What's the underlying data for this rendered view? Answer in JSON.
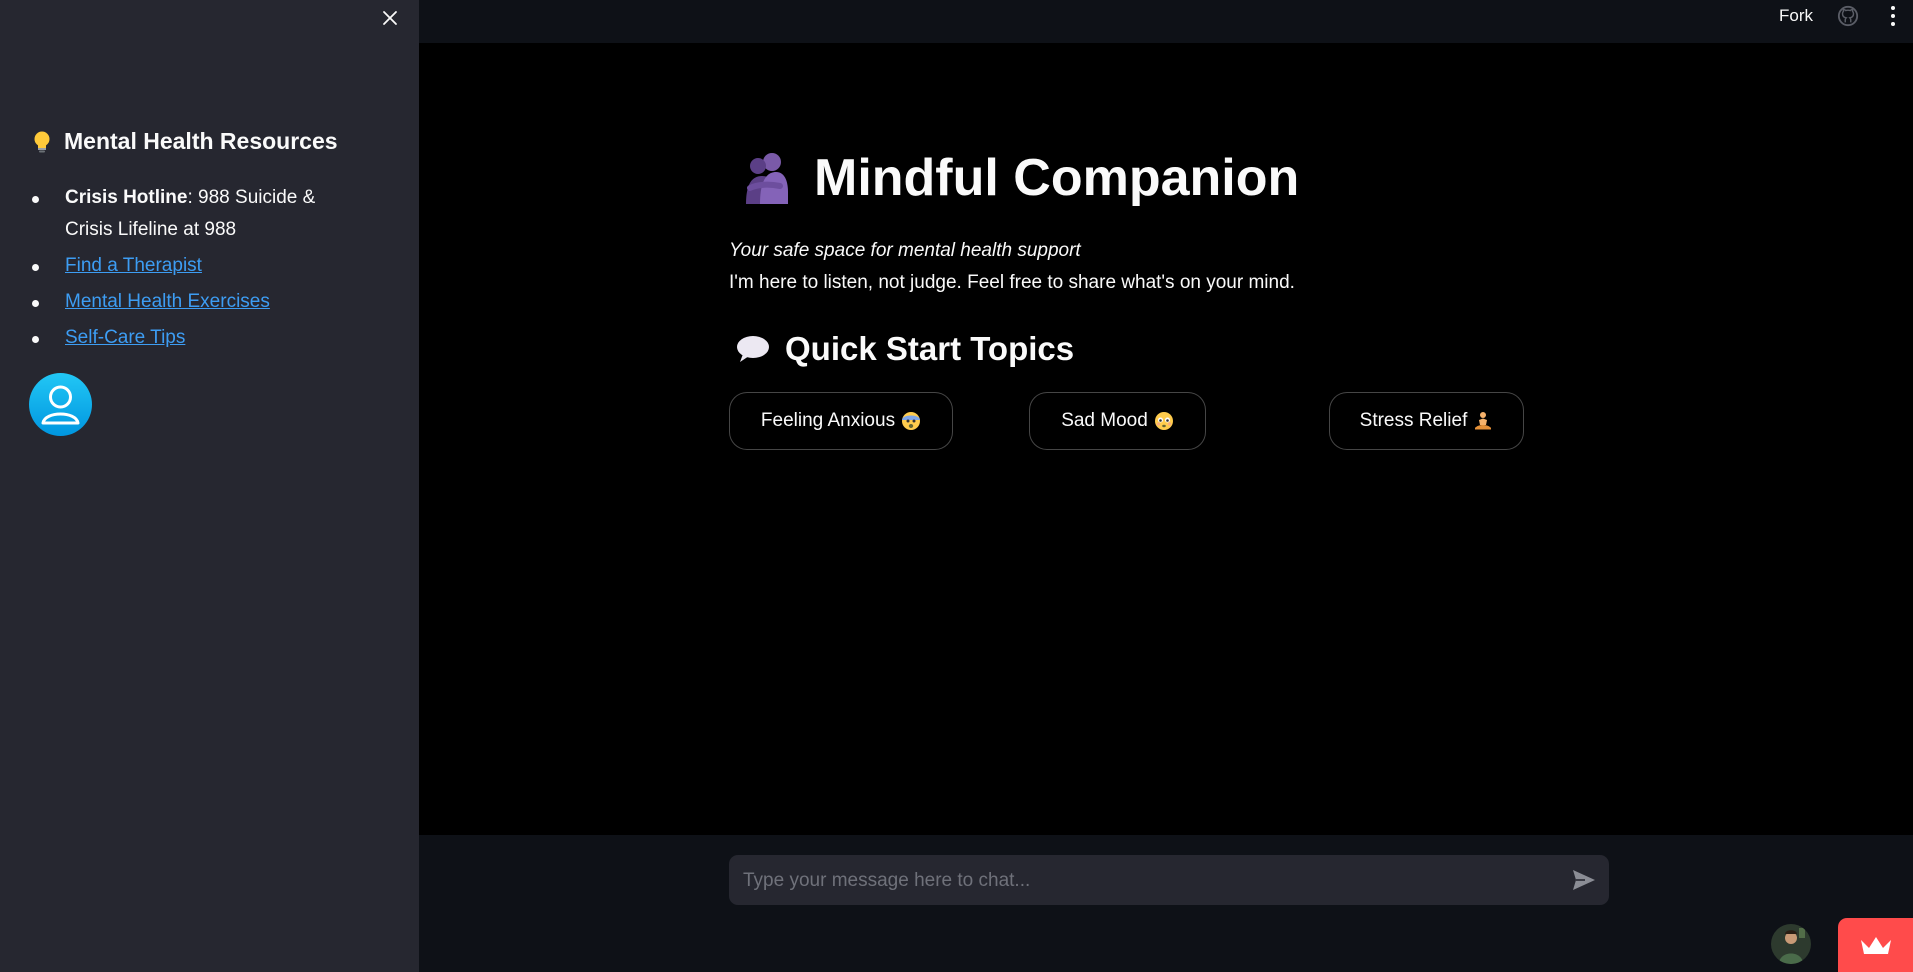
{
  "sidebar": {
    "close_icon": "close-icon",
    "title_icon": "lightbulb-icon",
    "title": "Mental Health Resources",
    "crisis": {
      "label": "Crisis Hotline",
      "text": ": 988 Suicide & Crisis Lifeline at 988"
    },
    "links": [
      {
        "label": "Find a Therapist"
      },
      {
        "label": "Mental Health Exercises"
      },
      {
        "label": "Self-Care Tips"
      }
    ],
    "avatar_icon": "user-avatar-icon"
  },
  "header": {
    "fork_label": "Fork",
    "github_icon": "github-icon",
    "menu_icon": "more-vertical-icon"
  },
  "main": {
    "title_icon": "people-hugging-icon",
    "title": "Mindful Companion",
    "subtitle": "Your safe space for mental health support",
    "tagline": "I'm here to listen, not judge. Feel free to share what's on your mind.",
    "quick_start": {
      "icon": "speech-balloon-icon",
      "title": "Quick Start Topics",
      "topics": [
        {
          "label": "Feeling Anxious",
          "emoji": "anxious-face-emoji"
        },
        {
          "label": "Sad Mood",
          "emoji": "sad-face-emoji"
        },
        {
          "label": "Stress Relief",
          "emoji": "meditating-person-emoji"
        }
      ]
    }
  },
  "chat": {
    "placeholder": "Type your message here to chat...",
    "send_icon": "send-icon"
  },
  "footer": {
    "bot_avatar": "bot-avatar-image",
    "crown_icon": "crown-icon"
  },
  "colors": {
    "sidebar_bg": "#262730",
    "main_bg": "#000000",
    "header_bg": "#0e1117",
    "link": "#3d9df3",
    "accent": "#ff4b4b",
    "avatar": "#00b4f0"
  }
}
